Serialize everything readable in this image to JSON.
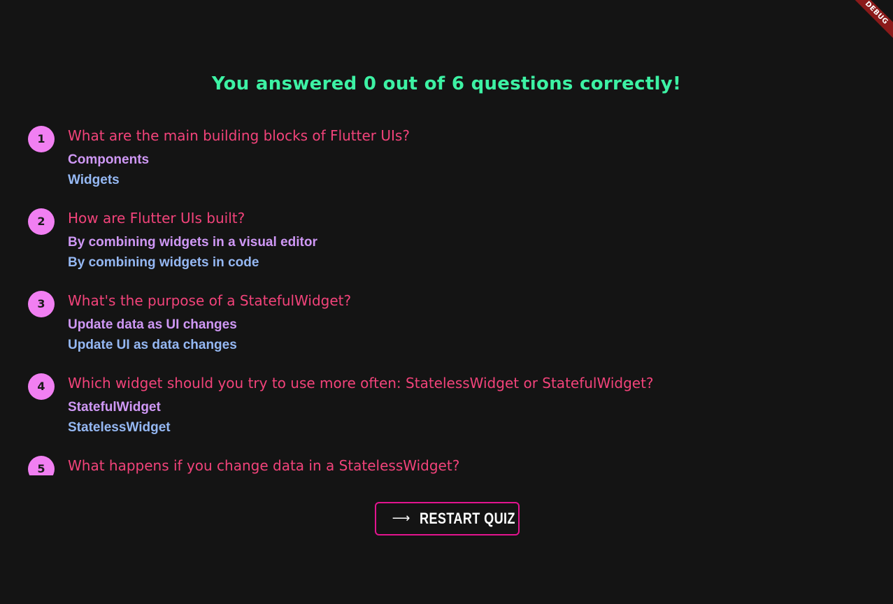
{
  "debug_banner": {
    "label": "DEBUG"
  },
  "summary": {
    "title": "You answered 0 out of 6 questions correctly!"
  },
  "questions": [
    {
      "number": "1",
      "question": "What are the main building blocks of Flutter UIs?",
      "user_answer": "Components",
      "correct_answer": "Widgets"
    },
    {
      "number": "2",
      "question": "How are Flutter UIs built?",
      "user_answer": "By combining widgets in a visual editor",
      "correct_answer": "By combining widgets in code"
    },
    {
      "number": "3",
      "question": "What's the purpose of a StatefulWidget?",
      "user_answer": "Update data as UI changes",
      "correct_answer": "Update UI as data changes"
    },
    {
      "number": "4",
      "question": "Which widget should you try to use more often: StatelessWidget or StatefulWidget?",
      "user_answer": "StatefulWidget",
      "correct_answer": "StatelessWidget"
    },
    {
      "number": "5",
      "question": "What happens if you change data in a StatelessWidget?",
      "user_answer": "",
      "correct_answer": ""
    }
  ],
  "restart": {
    "icon": "arrow-right-icon",
    "label": "RESTART QUIZ"
  },
  "colors": {
    "background": "#141414",
    "title": "#3df2a4",
    "question": "#f2437a",
    "number_badge": "#f17ff2",
    "user_answer": "#cf98f5",
    "correct_answer": "#95b8f3",
    "button_border": "#e3148f"
  }
}
